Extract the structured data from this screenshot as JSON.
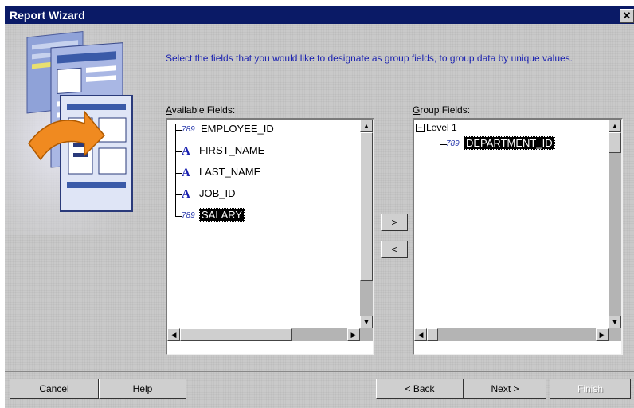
{
  "window": {
    "title": "Report Wizard",
    "close_glyph": "✕"
  },
  "instructions": "Select the fields that you would like to designate as group fields, to group data by unique values.",
  "available": {
    "label_accel": "A",
    "label_rest": "vailable Fields:",
    "items": [
      {
        "icon": "number-field-icon",
        "label": "EMPLOYEE_ID"
      },
      {
        "icon": "text-field-icon",
        "label": "FIRST_NAME"
      },
      {
        "icon": "text-field-icon",
        "label": "LAST_NAME"
      },
      {
        "icon": "text-field-icon",
        "label": "JOB_ID"
      },
      {
        "icon": "number-field-icon",
        "label": "SALARY",
        "selected": true
      }
    ]
  },
  "group": {
    "label_accel": "G",
    "label_rest": "roup Fields:",
    "level": "Level 1",
    "items": [
      {
        "icon": "number-field-icon",
        "label": "DEPARTMENT_ID",
        "selected": true
      }
    ]
  },
  "move_buttons": {
    "add": ">",
    "remove": "<"
  },
  "icons": {
    "number_glyph": "789",
    "text_glyph": "A"
  },
  "buttons": {
    "cancel": "Cancel",
    "help": "Help",
    "back": "< Back",
    "next": "Next >",
    "finish": "Finish"
  }
}
